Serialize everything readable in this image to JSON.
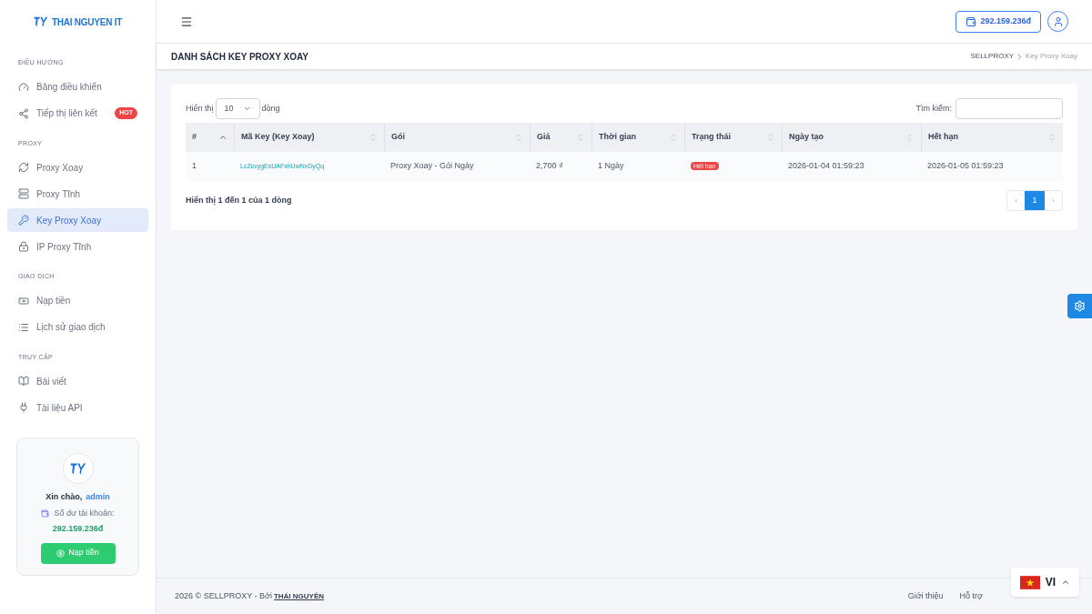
{
  "logo": {
    "text": "THAI NGUYEN IT"
  },
  "sidebar": {
    "sections": [
      {
        "title": "ĐIỀU HƯỚNG",
        "items": [
          {
            "label": "Bảng điều khiển",
            "selected": false
          },
          {
            "label": "Tiếp thị liên kết",
            "selected": false,
            "badge": "HOT"
          }
        ]
      },
      {
        "title": "PROXY",
        "items": [
          {
            "label": "Proxy Xoay",
            "selected": false
          },
          {
            "label": "Proxy Tĩnh",
            "selected": false
          },
          {
            "label": "Key Proxy Xoay",
            "selected": true
          },
          {
            "label": "IP Proxy Tĩnh",
            "selected": false
          }
        ]
      },
      {
        "title": "GIAO DỊCH",
        "items": [
          {
            "label": "Nạp tiền",
            "selected": false
          },
          {
            "label": "Lịch sử giao dịch",
            "selected": false
          }
        ]
      },
      {
        "title": "TRUY CẬP",
        "items": [
          {
            "label": "Bài viết",
            "selected": false
          },
          {
            "label": "Tài liệu API",
            "selected": false
          }
        ]
      }
    ]
  },
  "user_card": {
    "greeting": "Xin chào,",
    "username": "admin",
    "balance_label": "Số dư tài khoản:",
    "balance": "292.159.236đ",
    "button": "Nạp tiền"
  },
  "header": {
    "balance": "292.159.236đ"
  },
  "page": {
    "title": "DANH SÁCH KEY PROXY XOAY",
    "breadcrumb": [
      "SELLPROXY",
      "Key Proxy Xoay"
    ]
  },
  "table_controls": {
    "show_label": "Hiển thị",
    "page_size": "10",
    "rows_label": "dòng",
    "search_label": "Tìm kiếm:"
  },
  "table": {
    "columns": [
      {
        "label": "#",
        "sorted": true
      },
      {
        "label": "Mã Key (Key Xoay)",
        "sorted": false
      },
      {
        "label": "Gói",
        "sorted": false
      },
      {
        "label": "Giá",
        "sorted": false
      },
      {
        "label": "Thời gian",
        "sorted": false
      },
      {
        "label": "Trạng thái",
        "sorted": false
      },
      {
        "label": "Ngày tạo",
        "sorted": false
      },
      {
        "label": "Hết hạn",
        "sorted": false
      }
    ],
    "rows": [
      {
        "index": "1",
        "key": "LcZcvygEsUAFxhUwNxDyQq",
        "package": "Proxy Xoay - Gói Ngày",
        "price": "2,700 ₫",
        "duration": "1 Ngày",
        "status": {
          "text": "Hết hạn",
          "kind": "expired"
        },
        "created": "2026-01-04 01:59:23",
        "expires": "2026-01-05 01:59:23"
      }
    ]
  },
  "table_info": "Hiển thị 1 đến 1 của 1 dòng",
  "pagination": {
    "prev": "‹",
    "pages": [
      {
        "label": "1",
        "selected": true
      }
    ],
    "next": "›"
  },
  "footer": {
    "copyright": "2026 © SELLPROXY - Bởi",
    "author": "THÁI NGUYÊN",
    "links": [
      "Giới thiệu",
      "Hỗ trợ"
    ]
  },
  "language": {
    "code": "VI"
  }
}
